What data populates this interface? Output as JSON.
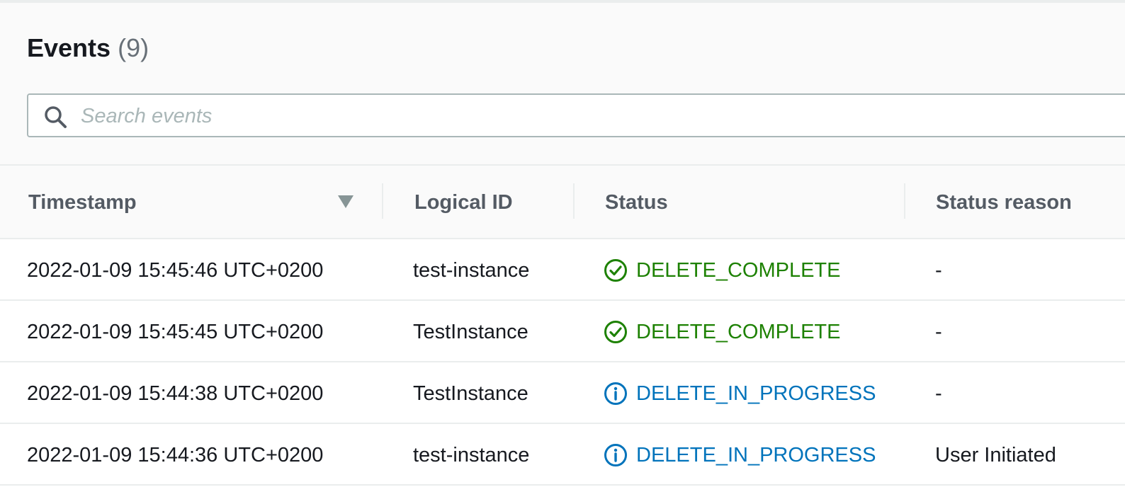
{
  "colors": {
    "success": "#1d8102",
    "info": "#0073bb",
    "header_text": "#545b64"
  },
  "events": {
    "title": "Events",
    "count": "(9)"
  },
  "search": {
    "icon": "search-icon",
    "placeholder": "Search events"
  },
  "table": {
    "columns": [
      {
        "label": "Timestamp",
        "sort": "descending"
      },
      {
        "label": "Logical ID"
      },
      {
        "label": "Status"
      },
      {
        "label": "Status reason"
      }
    ],
    "rows": [
      {
        "timestamp": "2022-01-09 15:45:46 UTC+0200",
        "logical_id": "test-instance",
        "status": "DELETE_COMPLETE",
        "status_type": "success",
        "status_icon": "check-circle-icon",
        "reason": "-"
      },
      {
        "timestamp": "2022-01-09 15:45:45 UTC+0200",
        "logical_id": "TestInstance",
        "status": "DELETE_COMPLETE",
        "status_type": "success",
        "status_icon": "check-circle-icon",
        "reason": "-"
      },
      {
        "timestamp": "2022-01-09 15:44:38 UTC+0200",
        "logical_id": "TestInstance",
        "status": "DELETE_IN_PROGRESS",
        "status_type": "info",
        "status_icon": "info-circle-icon",
        "reason": "-"
      },
      {
        "timestamp": "2022-01-09 15:44:36 UTC+0200",
        "logical_id": "test-instance",
        "status": "DELETE_IN_PROGRESS",
        "status_type": "info",
        "status_icon": "info-circle-icon",
        "reason": "User Initiated"
      }
    ]
  }
}
